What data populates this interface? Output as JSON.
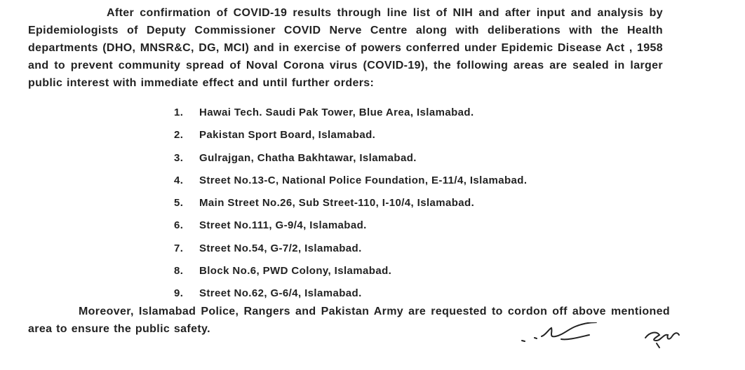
{
  "document": {
    "intro_paragraph": "After confirmation of COVID-19 results through line list of NIH and after input and analysis by Epidemiologists of Deputy Commissioner COVID Nerve Centre along with deliberations with the Health departments (DHO, MNSR&C, DG, MCI) and in exercise of powers conferred under Epidemic Disease Act , 1958 and to prevent community spread of Noval Corona virus (COVID-19), the following areas are sealed in larger public interest with immediate effect and until further orders:",
    "areas": [
      {
        "number": "1.",
        "text": "Hawai Tech. Saudi Pak Tower, Blue Area, Islamabad."
      },
      {
        "number": "2.",
        "text": "Pakistan Sport Board, Islamabad."
      },
      {
        "number": "3.",
        "text": "Gulrajgan, Chatha Bakhtawar, Islamabad."
      },
      {
        "number": "4.",
        "text": "Street No.13-C, National Police Foundation, E-11/4, Islamabad."
      },
      {
        "number": "5.",
        "text": "Main Street No.26, Sub Street-110, I-10/4, Islamabad."
      },
      {
        "number": "6.",
        "text": "Street No.111, G-9/4, Islamabad."
      },
      {
        "number": "7.",
        "text": "Street No.54, G-7/2, Islamabad."
      },
      {
        "number": "8.",
        "text": "Block No.6, PWD Colony,  Islamabad."
      },
      {
        "number": "9.",
        "text": "Street No.62, G-6/4, Islamabad."
      }
    ],
    "closing_paragraph": "Moreover, Islamabad Police, Rangers and Pakistan Army are requested to cordon off above mentioned area to ensure the public safety."
  }
}
